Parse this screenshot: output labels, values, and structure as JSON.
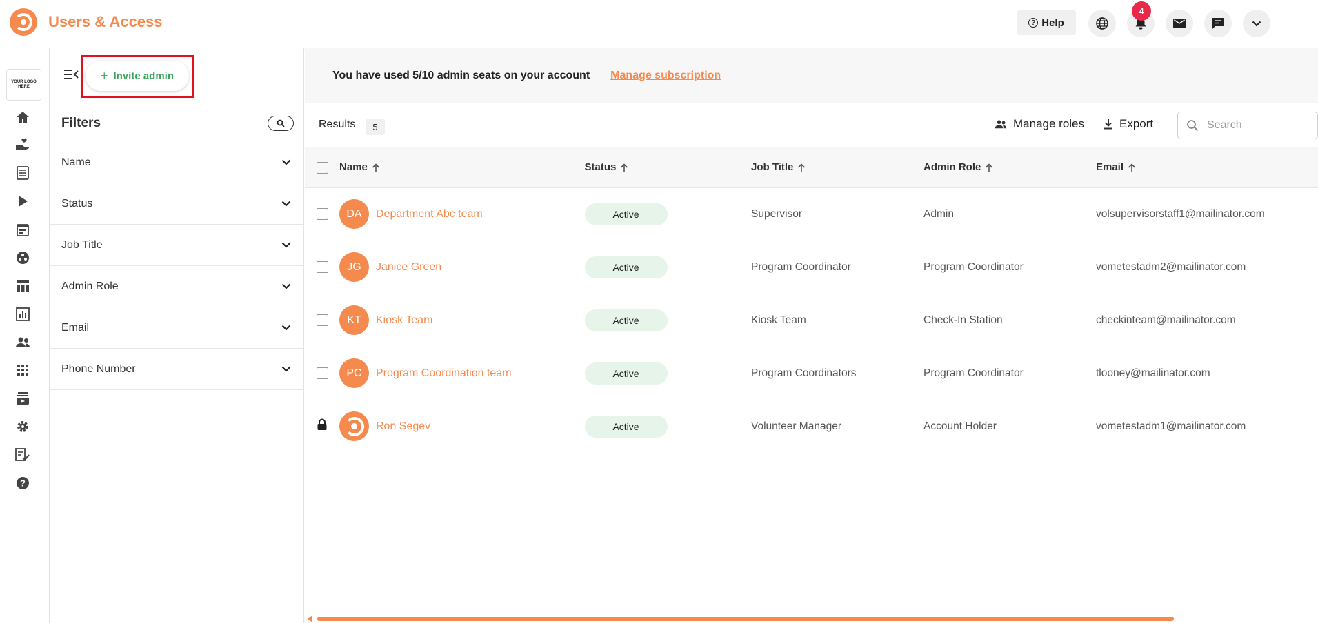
{
  "header": {
    "title": "Users & Access",
    "help_label": "Help",
    "notification_count": "4",
    "accent_color": "#f58a4f"
  },
  "rail": {
    "logo_text": "YOUR LOGO HERE",
    "icons": [
      "home-icon",
      "volunteer-hand-icon",
      "list-icon",
      "play-icon",
      "calendar-icon",
      "groups-icon",
      "dashboard-icon",
      "chart-icon",
      "people-icon",
      "apps-grid-icon",
      "subscriptions-icon",
      "gear-icon",
      "checklist-icon",
      "help-icon"
    ]
  },
  "filters": {
    "invite_label": "Invite admin",
    "title": "Filters",
    "items": [
      {
        "label": "Name"
      },
      {
        "label": "Status"
      },
      {
        "label": "Job Title"
      },
      {
        "label": "Admin Role"
      },
      {
        "label": "Email"
      },
      {
        "label": "Phone Number"
      }
    ]
  },
  "seats": {
    "text": "You have used 5/10 admin seats on your account",
    "link": "Manage subscription"
  },
  "results": {
    "label": "Results",
    "count": "5",
    "manage_roles": "Manage roles",
    "export": "Export",
    "search_placeholder": "Search"
  },
  "table": {
    "columns": [
      "Name",
      "Status",
      "Job Title",
      "Admin Role",
      "Email"
    ],
    "rows": [
      {
        "initials": "DA",
        "name": "Department Abc team",
        "status": "Active",
        "job": "Supervisor",
        "role": "Admin",
        "email": "volsupervisorstaff1@mailinator.com",
        "locked": false,
        "trunc": "5"
      },
      {
        "initials": "JG",
        "name": "Janice Green",
        "status": "Active",
        "job": "Program Coordinator",
        "role": "Program Coordinator",
        "email": "vometestadm2@mailinator.com",
        "locked": false,
        "trunc": "5"
      },
      {
        "initials": "KT",
        "name": "Kiosk Team",
        "status": "Active",
        "job": "Kiosk Team",
        "role": "Check-In Station",
        "email": "checkinteam@mailinator.com",
        "locked": false,
        "trunc": "6"
      },
      {
        "initials": "PC",
        "name": "Program Coordination team",
        "status": "Active",
        "job": "Program Coordinators",
        "role": "Program Coordinator",
        "email": "tlooney@mailinator.com",
        "locked": false,
        "trunc": "8"
      },
      {
        "initials": "",
        "name": "Ron Segev",
        "status": "Active",
        "job": "Volunteer Manager",
        "role": "Account Holder",
        "email": "vometestadm1@mailinator.com",
        "locked": true,
        "trunc": "5"
      }
    ]
  }
}
